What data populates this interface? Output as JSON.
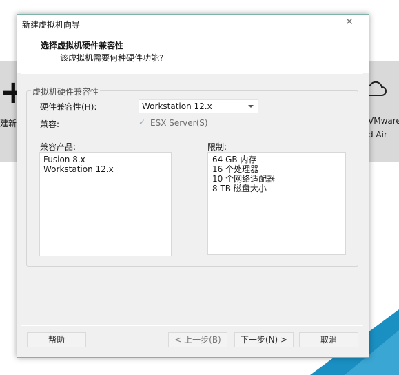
{
  "background": {
    "left_partial_text": "建新的",
    "right_partial_text_1": "VMware",
    "right_partial_text_2": "d Air",
    "plus_icon": "plus-icon",
    "cloud_icon": "cloud-icon",
    "corner_color": "#1a8fc2"
  },
  "dialog": {
    "title": "新建虚拟机向导",
    "close_icon": "close-icon",
    "header_title": "选择虚拟机硬件兼容性",
    "header_subtitle": "该虚拟机需要何种硬件功能?"
  },
  "compat_group": {
    "label": "虚拟机硬件兼容性",
    "hw_compat_label": "硬件兼容性(H):",
    "hw_compat_value": "Workstation 12.x",
    "compat_label": "兼容:",
    "esx_check_label": "ESX Server(S)",
    "esx_checked": true,
    "products_label": "兼容产品:",
    "products": [
      "Fusion 8.x",
      "Workstation 12.x"
    ],
    "limits_label": "限制:",
    "limits": [
      "64 GB 内存",
      "16 个处理器",
      "10 个网络适配器",
      "8 TB 磁盘大小"
    ]
  },
  "buttons": {
    "help": "帮助",
    "back": "< 上一步(B)",
    "next": "下一步(N) >",
    "cancel": "取消"
  },
  "colors": {
    "dialog_bg": "#f0f0f0",
    "dialog_border": "#7eb4a8",
    "window_white": "#ffffff",
    "disabled_text": "#6d6d6d"
  }
}
